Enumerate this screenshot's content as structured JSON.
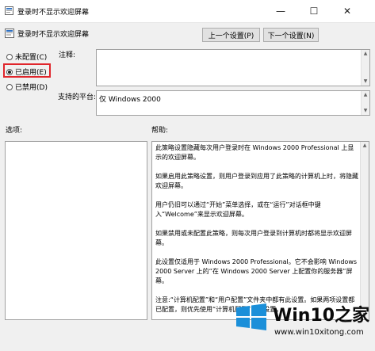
{
  "window": {
    "title": "登录时不显示欢迎屏幕",
    "minimize_glyph": "—",
    "maximize_glyph": "☐",
    "close_glyph": "✕"
  },
  "header": {
    "policy_title": "登录时不显示欢迎屏幕",
    "prev_button": "上一个设置(P)",
    "next_button": "下一个设置(N)"
  },
  "options": {
    "not_configured": "未配置(C)",
    "enabled": "已启用(E)",
    "disabled": "已禁用(D)",
    "selected": "enabled"
  },
  "comment": {
    "label": "注释:",
    "value": ""
  },
  "supported": {
    "label": "支持的平台:",
    "value": "仅 Windows 2000"
  },
  "panes": {
    "options_label": "选项:",
    "help_label": "帮助:"
  },
  "help": {
    "paragraphs": [
      "此策略设置隐藏每次用户登录时在 Windows 2000 Professional 上显示的欢迎屏幕。",
      "如果启用此策略设置，则用户登录到应用了此策略的计算机上时，将隐藏欢迎屏幕。",
      "用户仍旧可以通过“开始”菜单选择，或在“运行”对话框中键入“Welcome”来显示欢迎屏幕。",
      "如果禁用或未配置此策略，则每次用户登录到计算机时都将显示欢迎屏幕。",
      "此设置仅适用于 Windows 2000 Professional。它不会影响 Windows 2000 Server 上的“在 Windows 2000 Server 上配置你的服务器”屏幕。",
      "注意:“计算机配置”和“用户配置”文件夹中都有此设置。如果两项设置都已配置，则优先使用“计算机配置”中的设置。"
    ]
  },
  "watermark": {
    "brand": "Win10之家",
    "url": "www.win10xitong.com",
    "colors": {
      "blue": "#1b8fd9"
    }
  }
}
